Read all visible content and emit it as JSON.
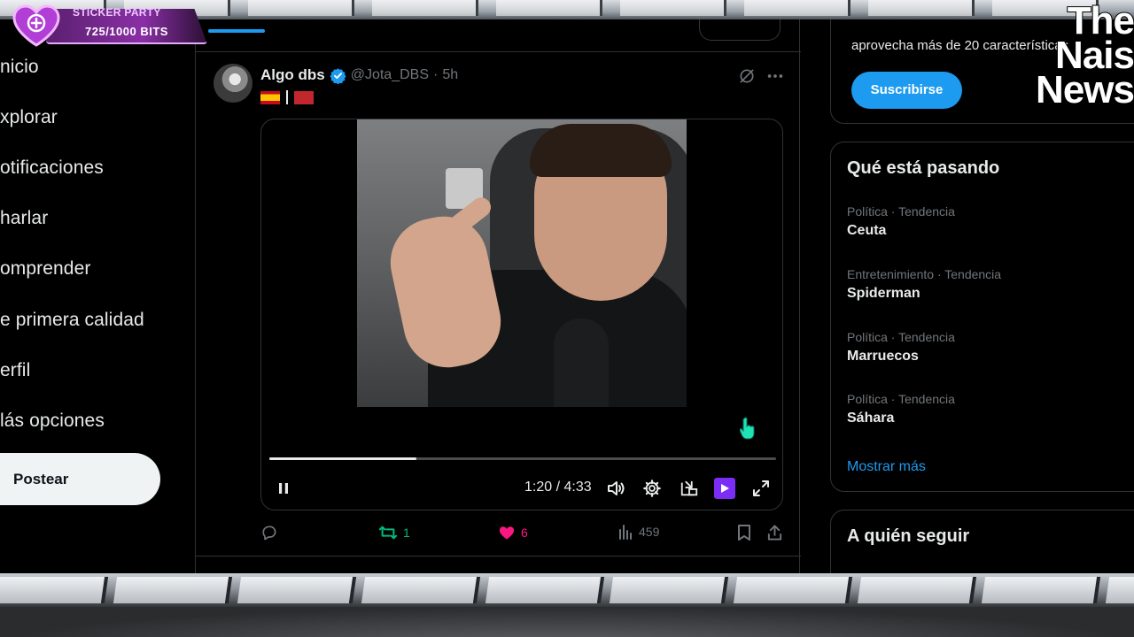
{
  "overlay": {
    "badge_title": "STICKER PARTY",
    "badge_bits": "725/1000 BITS",
    "logo_lines": [
      "The",
      "Nais",
      "News"
    ]
  },
  "sidebar": {
    "items": [
      {
        "label": "nicio"
      },
      {
        "label": "xplorar"
      },
      {
        "label": "otificaciones"
      },
      {
        "label": "harlar"
      },
      {
        "label": "omprender"
      },
      {
        "label": "e primera calidad"
      },
      {
        "label": "erfil"
      },
      {
        "label": "lás opciones"
      }
    ],
    "post_button": "Postear"
  },
  "tweet": {
    "author_name": "Algo dbs",
    "handle": "@Jota_DBS",
    "separator": "·",
    "time": "5h",
    "video": {
      "progress": 0.29,
      "time_display": "1:20 / 4:33"
    },
    "actions": {
      "retweets": "1",
      "likes": "6",
      "views": "459"
    }
  },
  "right": {
    "premium_text": "aprovecha más de 20 características",
    "subscribe_label": "Suscribirse",
    "trends_title": "Qué está pasando",
    "trends": [
      {
        "meta": "Política · Tendencia",
        "topic": "Ceuta"
      },
      {
        "meta": "Entretenimiento · Tendencia",
        "topic": "Spiderman"
      },
      {
        "meta": "Política · Tendencia",
        "topic": "Marruecos"
      },
      {
        "meta": "Política · Tendencia",
        "topic": "Sáhara"
      }
    ],
    "show_more": "Mostrar más",
    "follow_title": "A quién seguir"
  },
  "colors": {
    "accent": "#1d9bf0",
    "like": "#f91880",
    "retweet": "#00ba7c",
    "grok_button": "#7b2cf5"
  }
}
